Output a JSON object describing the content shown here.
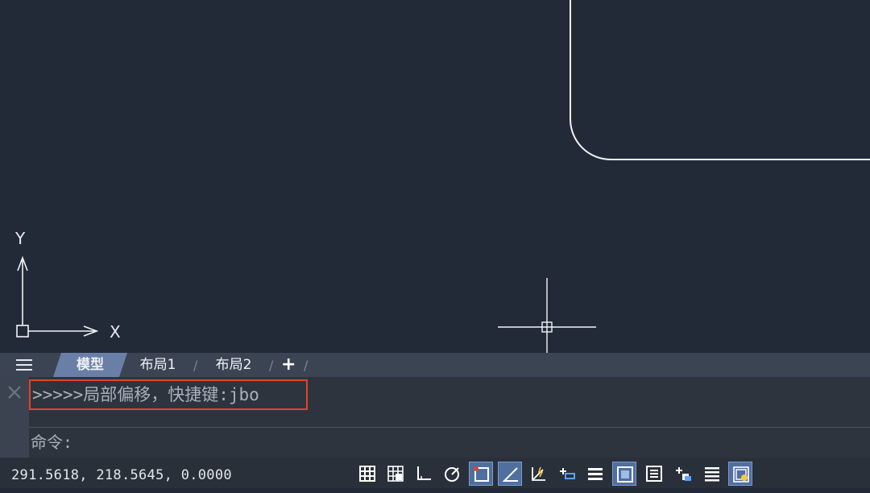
{
  "canvas": {
    "background": "#222a38",
    "ucs_y_label": "Y",
    "ucs_x_label": "X"
  },
  "tabs": {
    "menu_icon": "hamburger-menu-icon",
    "items": [
      {
        "label": "模型",
        "active": true
      },
      {
        "label": "布局1",
        "active": false
      },
      {
        "label": "布局2",
        "active": false
      }
    ],
    "add_label": "+",
    "separator": "/"
  },
  "command": {
    "history_line": ">>>>>局部偏移，快捷键:jbo",
    "prompt": "命令:",
    "input_value": "",
    "highlight_color": "#e0442b"
  },
  "status": {
    "coordinates": "291.5618,  218.5645,  0.0000",
    "buttons": [
      {
        "icon": "grid-display-icon",
        "active": false
      },
      {
        "icon": "snap-mode-icon",
        "active": false
      },
      {
        "icon": "ortho-mode-icon",
        "active": false
      },
      {
        "icon": "polar-tracking-icon",
        "active": false
      },
      {
        "icon": "object-snap-icon",
        "active": true
      },
      {
        "icon": "object-snap-tracking-icon",
        "active": true
      },
      {
        "icon": "dynamic-ucs-icon",
        "active": false
      },
      {
        "icon": "dynamic-input-icon",
        "active": false
      },
      {
        "icon": "lineweight-icon",
        "active": false
      },
      {
        "icon": "transparency-icon",
        "active": true
      },
      {
        "icon": "quick-properties-icon",
        "active": false
      },
      {
        "icon": "selection-cycling-icon",
        "active": false
      },
      {
        "icon": "annotation-monitor-icon",
        "active": false
      },
      {
        "icon": "isolate-objects-icon",
        "active": false
      }
    ]
  }
}
